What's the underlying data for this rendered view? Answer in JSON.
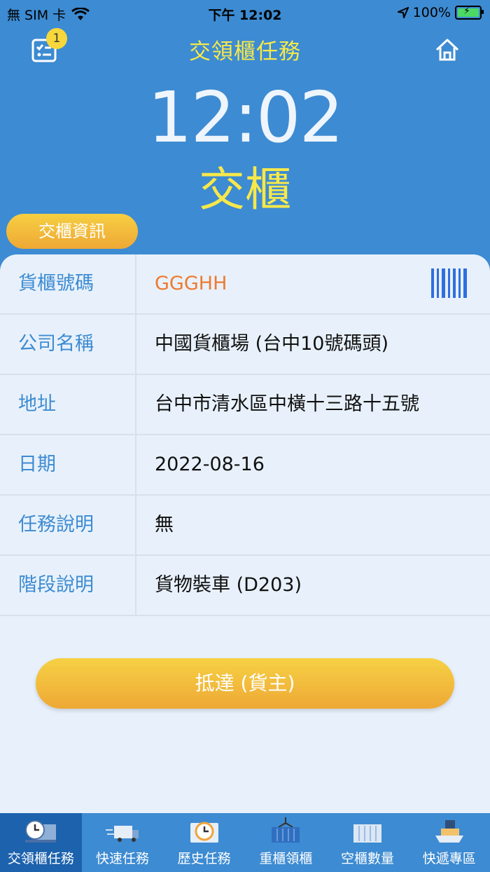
{
  "status_bar": {
    "carrier": "無 SIM 卡",
    "time": "下午 12:02",
    "battery": "100%"
  },
  "header": {
    "title": "交領櫃任務",
    "badge_count": "1"
  },
  "clock": "12:02",
  "mode": "交櫃",
  "info_tab_label": "交櫃資訊",
  "rows": [
    {
      "label": "貨櫃號碼",
      "value": "GGGHH"
    },
    {
      "label": "公司名稱",
      "value": "中國貨櫃場 (台中10號碼頭)"
    },
    {
      "label": "地址",
      "value": "台中市清水區中橫十三路十五號"
    },
    {
      "label": "日期",
      "value": "2022-08-16"
    },
    {
      "label": "任務說明",
      "value": "無"
    },
    {
      "label": "階段說明",
      "value": "貨物裝車 (D203)"
    }
  ],
  "action_button": "抵達 (貨主)",
  "tabs": [
    {
      "label": "交領櫃任務",
      "icon": "clock-truck-icon"
    },
    {
      "label": "快速任務",
      "icon": "fast-truck-icon"
    },
    {
      "label": "歷史任務",
      "icon": "history-icon"
    },
    {
      "label": "重櫃領櫃",
      "icon": "crane-container-icon"
    },
    {
      "label": "空櫃數量",
      "icon": "empty-container-icon"
    },
    {
      "label": "快遞專區",
      "icon": "express-ship-icon"
    }
  ],
  "colors": {
    "background": "#3d8bd2",
    "accent_yellow": "#f7e84a",
    "button_orange": "#eea835",
    "value_orange": "#ee7a2e",
    "card": "#e8f1fb"
  }
}
